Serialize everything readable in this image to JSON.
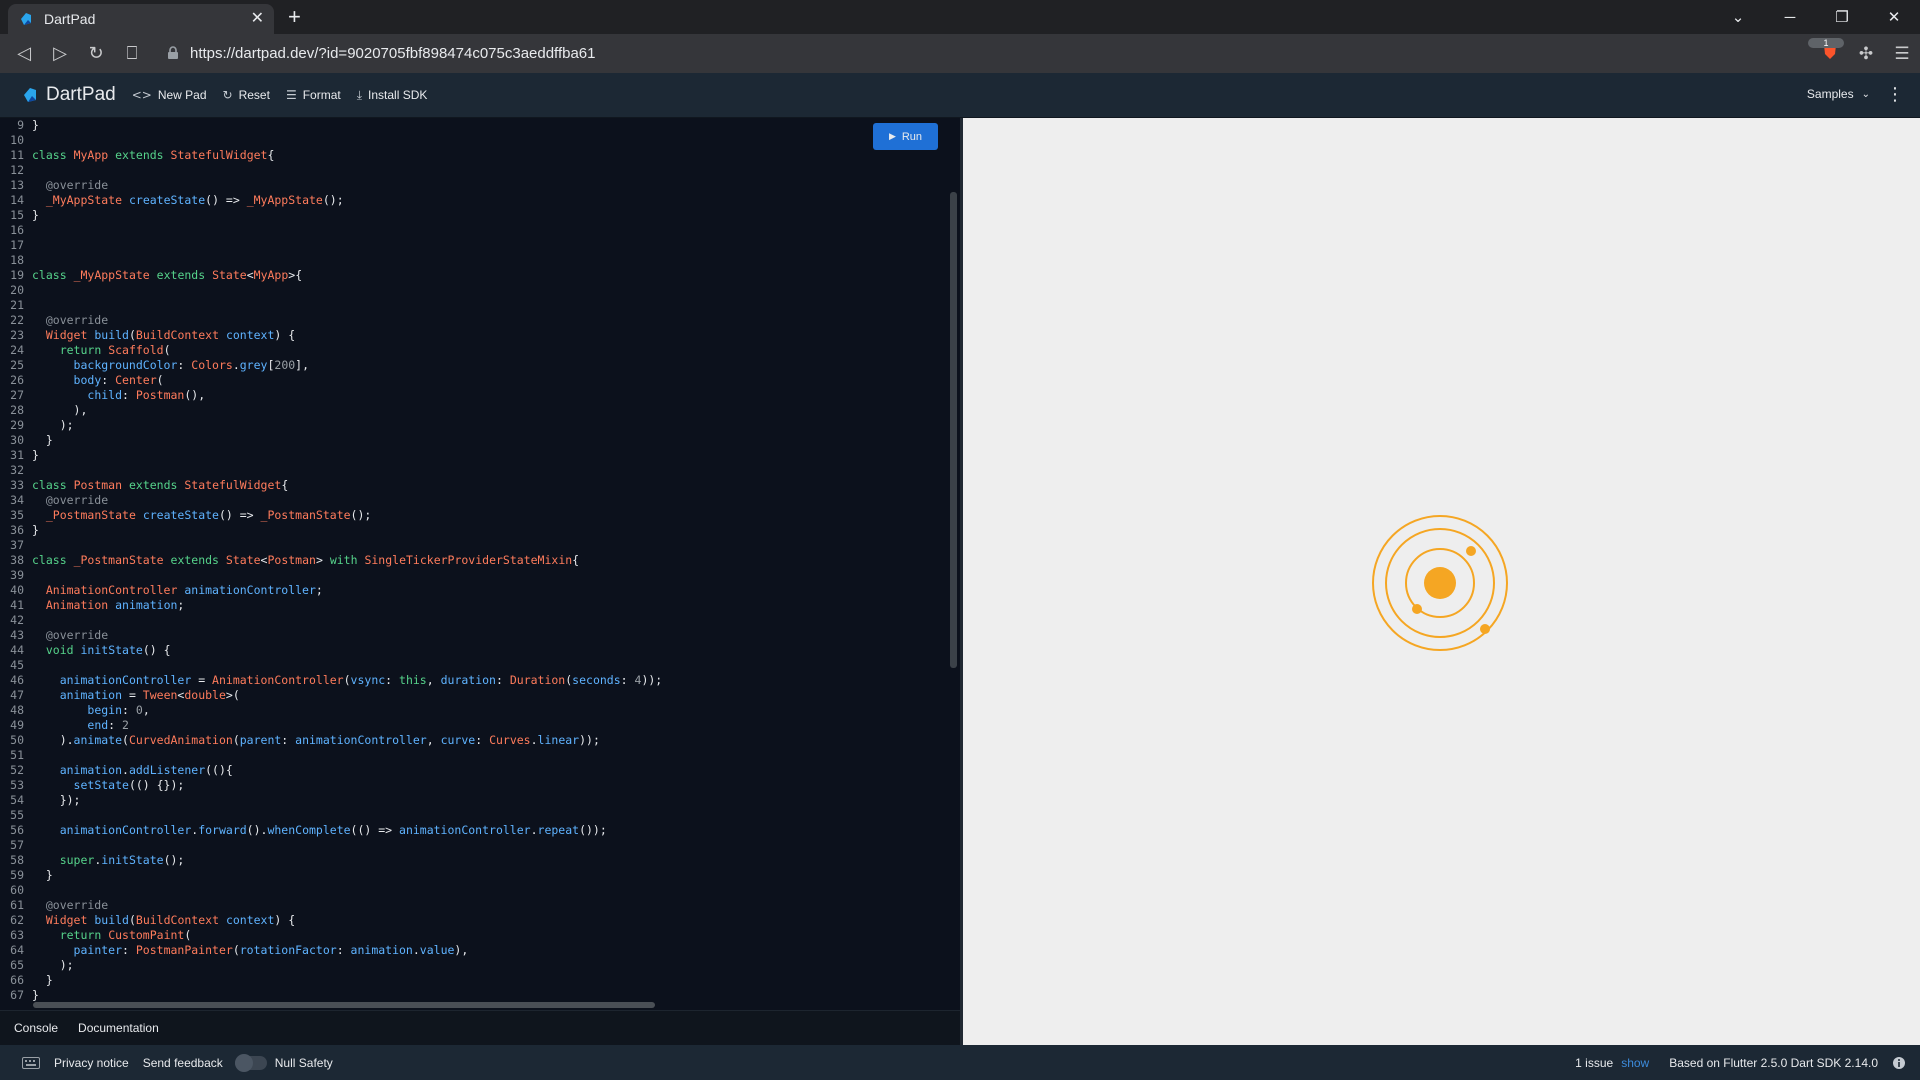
{
  "browser": {
    "tab_title": "DartPad",
    "url": "https://dartpad.dev/?id=9020705fbf898474c075c3aeddffba61",
    "extension_badge": "1"
  },
  "toolbar": {
    "brand": "DartPad",
    "new_pad": "New Pad",
    "reset": "Reset",
    "format": "Format",
    "install_sdk": "Install SDK",
    "samples": "Samples"
  },
  "editor": {
    "run_label": "Run",
    "lines": [
      {
        "n": "9",
        "t": "}"
      },
      {
        "n": "10",
        "t": ""
      },
      {
        "n": "11",
        "t": "class MyApp extends StatefulWidget{"
      },
      {
        "n": "12",
        "t": ""
      },
      {
        "n": "13",
        "t": "  @override"
      },
      {
        "n": "14",
        "t": "  _MyAppState createState() => _MyAppState();"
      },
      {
        "n": "15",
        "t": "}"
      },
      {
        "n": "16",
        "t": ""
      },
      {
        "n": "17",
        "t": ""
      },
      {
        "n": "18",
        "t": ""
      },
      {
        "n": "19",
        "t": "class _MyAppState extends State<MyApp>{"
      },
      {
        "n": "20",
        "t": ""
      },
      {
        "n": "21",
        "t": ""
      },
      {
        "n": "22",
        "t": "  @override"
      },
      {
        "n": "23",
        "t": "  Widget build(BuildContext context) {"
      },
      {
        "n": "24",
        "t": "    return Scaffold("
      },
      {
        "n": "25",
        "t": "      backgroundColor: Colors.grey[200],"
      },
      {
        "n": "26",
        "t": "      body: Center("
      },
      {
        "n": "27",
        "t": "        child: Postman(),"
      },
      {
        "n": "28",
        "t": "      ),"
      },
      {
        "n": "29",
        "t": "    );"
      },
      {
        "n": "30",
        "t": "  }"
      },
      {
        "n": "31",
        "t": "}"
      },
      {
        "n": "32",
        "t": ""
      },
      {
        "n": "33",
        "t": "class Postman extends StatefulWidget{"
      },
      {
        "n": "34",
        "t": "  @override"
      },
      {
        "n": "35",
        "t": "  _PostmanState createState() => _PostmanState();"
      },
      {
        "n": "36",
        "t": "}"
      },
      {
        "n": "37",
        "t": ""
      },
      {
        "n": "38",
        "t": "class _PostmanState extends State<Postman> with SingleTickerProviderStateMixin{"
      },
      {
        "n": "39",
        "t": ""
      },
      {
        "n": "40",
        "t": "  AnimationController animationController;"
      },
      {
        "n": "41",
        "t": "  Animation animation;"
      },
      {
        "n": "42",
        "t": ""
      },
      {
        "n": "43",
        "t": "  @override"
      },
      {
        "n": "44",
        "t": "  void initState() {"
      },
      {
        "n": "45",
        "t": ""
      },
      {
        "n": "46",
        "t": "    animationController = AnimationController(vsync: this, duration: Duration(seconds: 4));"
      },
      {
        "n": "47",
        "t": "    animation = Tween<double>("
      },
      {
        "n": "48",
        "t": "        begin: 0,"
      },
      {
        "n": "49",
        "t": "        end: 2"
      },
      {
        "n": "50",
        "t": "    ).animate(CurvedAnimation(parent: animationController, curve: Curves.linear));"
      },
      {
        "n": "51",
        "t": ""
      },
      {
        "n": "52",
        "t": "    animation.addListener((){"
      },
      {
        "n": "53",
        "t": "      setState(() {});"
      },
      {
        "n": "54",
        "t": "    });"
      },
      {
        "n": "55",
        "t": ""
      },
      {
        "n": "56",
        "t": "    animationController.forward().whenComplete(() => animationController.repeat());"
      },
      {
        "n": "57",
        "t": ""
      },
      {
        "n": "58",
        "t": "    super.initState();"
      },
      {
        "n": "59",
        "t": "  }"
      },
      {
        "n": "60",
        "t": ""
      },
      {
        "n": "61",
        "t": "  @override"
      },
      {
        "n": "62",
        "t": "  Widget build(BuildContext context) {"
      },
      {
        "n": "63",
        "t": "    return CustomPaint("
      },
      {
        "n": "64",
        "t": "      painter: PostmanPainter(rotationFactor: animation.value),"
      },
      {
        "n": "65",
        "t": "    );"
      },
      {
        "n": "66",
        "t": "  }"
      },
      {
        "n": "67",
        "t": "}"
      }
    ]
  },
  "console_tabs": [
    "Console",
    "Documentation"
  ],
  "footer": {
    "privacy": "Privacy notice",
    "feedback": "Send feedback",
    "null_safety": "Null Safety",
    "issues": "1 issue",
    "show": "show",
    "version": "Based on Flutter 2.5.0 Dart SDK 2.14.0"
  },
  "colors": {
    "accent": "#1f70d6",
    "orbit": "#f5a623",
    "output_bg": "#eeeeee"
  }
}
